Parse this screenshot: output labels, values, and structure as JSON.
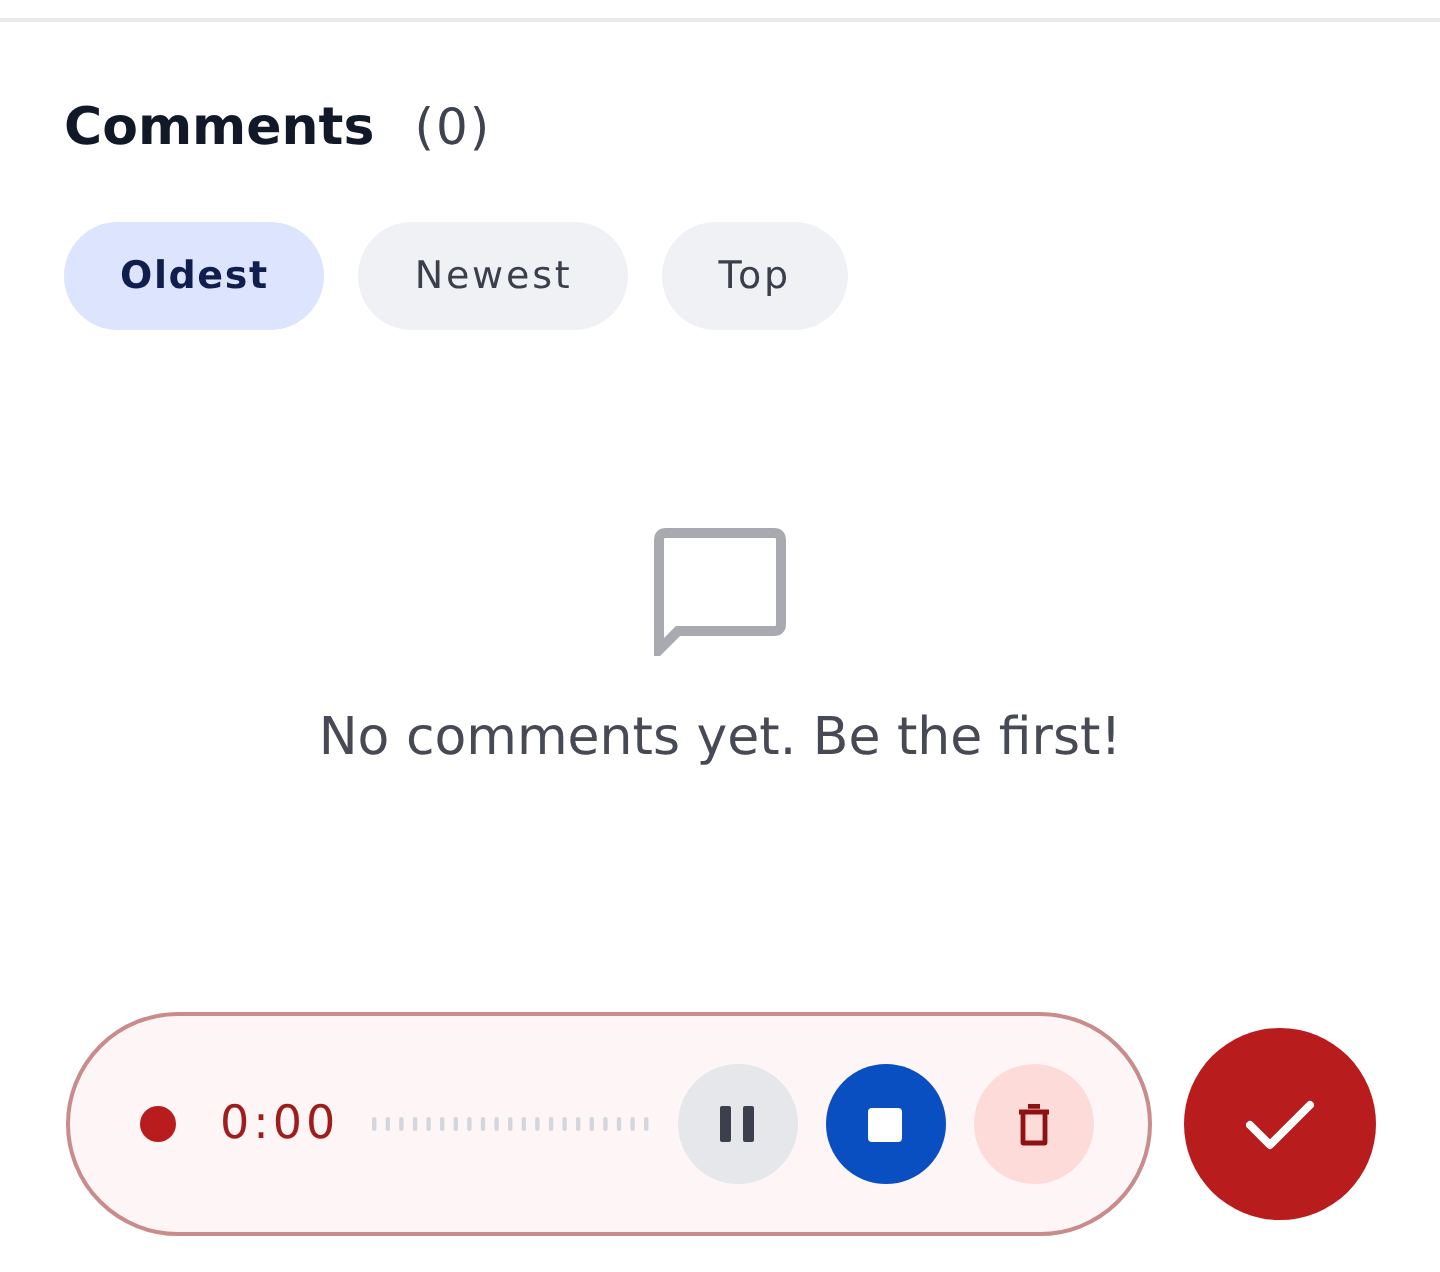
{
  "comments": {
    "title": "Comments",
    "count": "(0)",
    "sort_options": [
      {
        "label": "Oldest",
        "selected": true
      },
      {
        "label": "Newest",
        "selected": false
      },
      {
        "label": "Top",
        "selected": false
      }
    ],
    "empty_state": {
      "message": "No comments yet. Be the first!"
    }
  },
  "recorder": {
    "recording": true,
    "time": "0:00",
    "controls": [
      {
        "kind": "pause"
      },
      {
        "kind": "stop"
      },
      {
        "kind": "delete"
      }
    ]
  }
}
